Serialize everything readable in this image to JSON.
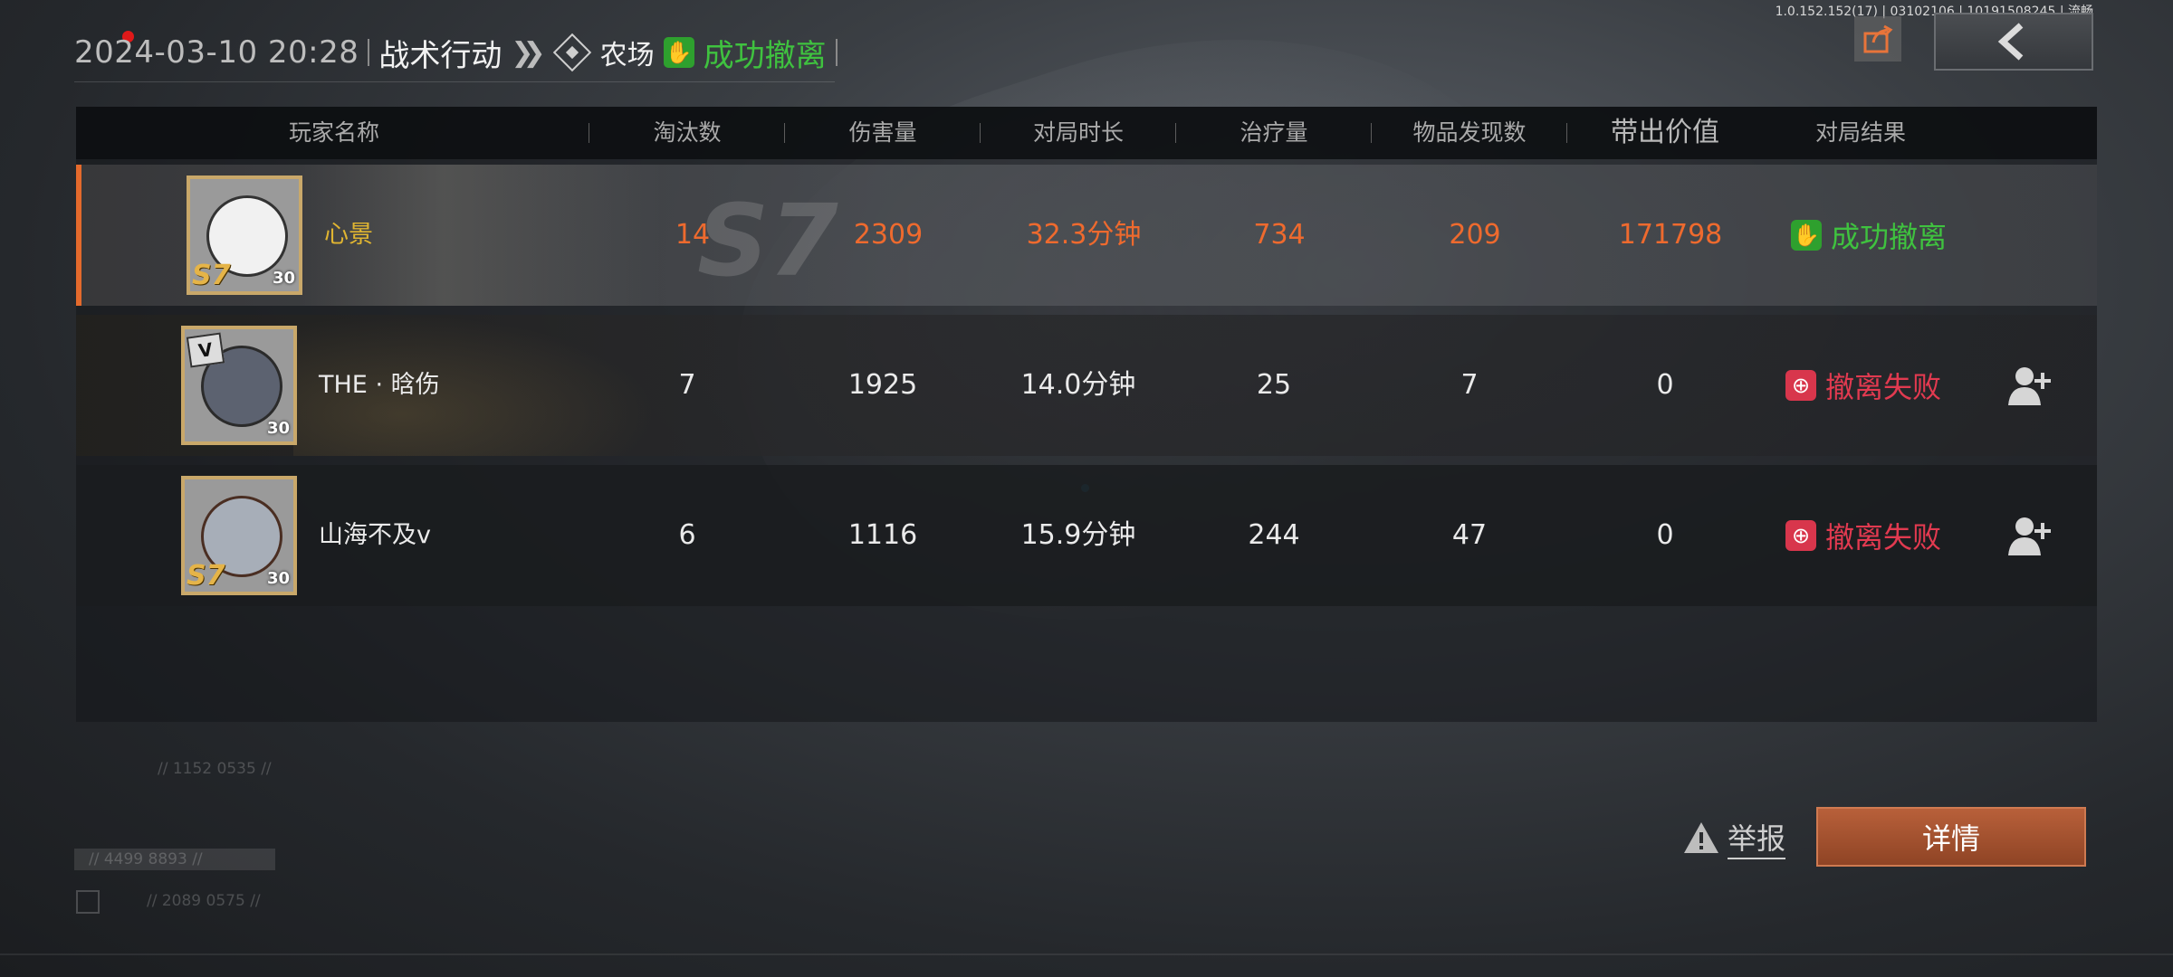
{
  "version_text": "1.0.152.152(17) | 03102106 | 10191508245 | 流畅",
  "header": {
    "datetime": "2024-03-10 20:28",
    "mode": "战术行动",
    "map": "农场",
    "result": "成功撤离"
  },
  "table": {
    "columns": [
      "玩家名称",
      "淘汰数",
      "伤害量",
      "对局时长",
      "治疗量",
      "物品发现数",
      "带出价值",
      "对局结果"
    ],
    "rows": [
      {
        "name": "心景",
        "level": "30",
        "season": "S7",
        "eliminations": "14",
        "damage": "2309",
        "duration": "32.3分钟",
        "healing": "734",
        "items_found": "209",
        "value_out": "171798",
        "result": "成功撤离",
        "result_type": "success"
      },
      {
        "name": "THE · 晗伤",
        "level": "30",
        "season": "",
        "eliminations": "7",
        "damage": "1925",
        "duration": "14.0分钟",
        "healing": "25",
        "items_found": "7",
        "value_out": "0",
        "result": "撤离失败",
        "result_type": "fail"
      },
      {
        "name": "山海不及v",
        "level": "30",
        "season": "S7",
        "eliminations": "6",
        "damage": "1116",
        "duration": "15.9分钟",
        "healing": "244",
        "items_found": "47",
        "value_out": "0",
        "result": "撤离失败",
        "result_type": "fail"
      }
    ]
  },
  "background_text": {
    "season_art": "S7",
    "code1": "// 1152 0535 //",
    "code2": "// 4499 8893 //",
    "code3": "// 2089 0575 //"
  },
  "actions": {
    "report_label": "举报",
    "details_label": "详情"
  },
  "icons": [
    "share-icon",
    "back-arrow-icon",
    "map-diamond-icon",
    "thumbs-up-icon",
    "fail-target-icon",
    "add-friend-icon",
    "warning-icon"
  ],
  "colors": {
    "accent_orange": "#ee6a2e",
    "success_green": "#3fc23f",
    "fail_red": "#e23a50",
    "gold": "#e0b531",
    "details_button": "#a4532f"
  }
}
